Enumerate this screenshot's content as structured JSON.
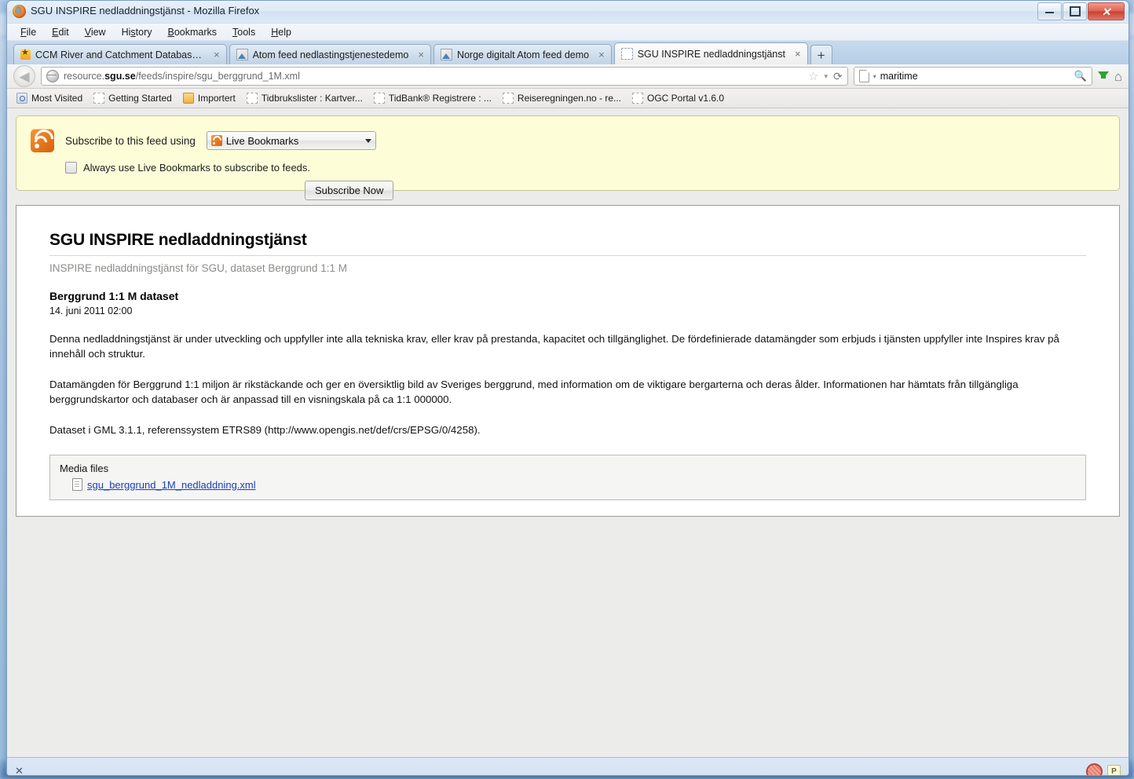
{
  "window": {
    "title": "SGU INSPIRE nedladdningstjänst - Mozilla Firefox",
    "minimize_label": "",
    "maximize_label": "",
    "close_label": "✕"
  },
  "menubar": [
    {
      "label": "File"
    },
    {
      "label": "Edit"
    },
    {
      "label": "View"
    },
    {
      "label": "History"
    },
    {
      "label": "Bookmarks"
    },
    {
      "label": "Tools"
    },
    {
      "label": "Help"
    }
  ],
  "tabs": [
    {
      "label": "CCM River and Catchment Database, ...",
      "icon": "star-favicon",
      "close": "×",
      "active": false
    },
    {
      "label": "Atom feed nedlastingstjenestedemo",
      "icon": "image-favicon",
      "close": "×",
      "active": false
    },
    {
      "label": "Norge digitalt Atom feed demo",
      "icon": "image-favicon",
      "close": "×",
      "active": false
    },
    {
      "label": "SGU INSPIRE nedladdningstjänst",
      "icon": "blank-favicon",
      "close": "×",
      "active": true
    }
  ],
  "newtab_label": "+",
  "navbar": {
    "back_label": "◀",
    "url_prefix": "resource.",
    "url_domain": "sgu.se",
    "url_suffix": "/feeds/inspire/sgu_berggrund_1M.xml",
    "star_icon": "☆",
    "caret_icon": "▾",
    "reload_icon": "⟳",
    "search_value": "maritime",
    "search_icon": "search-magnifier",
    "download_icon": "download-arrow",
    "home_icon": "⌂"
  },
  "bookmarks": [
    {
      "label": "Most Visited",
      "icon": "most-visited"
    },
    {
      "label": "Getting Started",
      "icon": "dashed-doc"
    },
    {
      "label": "Importert",
      "icon": "folder"
    },
    {
      "label": "Tidbrukslister : Kartver...",
      "icon": "dashed-doc"
    },
    {
      "label": "TidBank® Registrere : ...",
      "icon": "dashed-doc"
    },
    {
      "label": "Reiseregningen.no - re...",
      "icon": "dashed-doc"
    },
    {
      "label": "OGC Portal v1.6.0",
      "icon": "dashed-doc"
    }
  ],
  "feedbar": {
    "icon": "rss-icon",
    "label": "Subscribe to this feed using",
    "reader_selected": "Live Bookmarks",
    "reader_options": [
      "Live Bookmarks"
    ],
    "checkbox_label": "Always use Live Bookmarks to subscribe to feeds.",
    "checkbox_checked": false,
    "subscribe_button": "Subscribe Now"
  },
  "feed": {
    "title": "SGU INSPIRE nedladdningstjänst",
    "subtitle": "INSPIRE nedladdningstjänst för SGU, dataset Berggrund 1:1 M",
    "entry_title": "Berggrund 1:1 M dataset",
    "entry_date": "14. juni 2011 02:00",
    "paragraph_1": "Denna nedladdningstjänst är under utveckling och uppfyller inte alla tekniska krav, eller krav på prestanda, kapacitet och tillgänglighet. De fördefinierade datamängder som erbjuds i tjänsten uppfyller inte Inspires krav på innehåll och struktur.",
    "paragraph_2": "Datamängden för Berggrund 1:1 miljon är rikstäckande och ger en översiktlig bild av Sveriges berggrund, med information om de viktigare bergarterna och deras ålder. Informationen har hämtats från tillgängliga berggrundskartor och databaser och är anpassad till en visningskala på ca 1:1 000000.",
    "paragraph_3": "Dataset i GML 3.1.1, referenssystem ETRS89 (http://www.opengis.net/def/crs/EPSG/0/4258).",
    "media_heading": "Media files",
    "media_link": "sgu_berggrund_1M_nedladdning.xml"
  },
  "findbar": {
    "close_icon": "✕",
    "highlight_icon": "highlight-all-magnifier",
    "badge_label": "P"
  },
  "colors": {
    "feedbar_background": "#fdfdd8",
    "feedbar_border": "#c5c79a",
    "page_background": "#ececea",
    "panel_background": "#ffffff",
    "link": "#1c3fb4",
    "rss_orange": "#e8761a",
    "findbar_background": "#d6e3f3"
  }
}
